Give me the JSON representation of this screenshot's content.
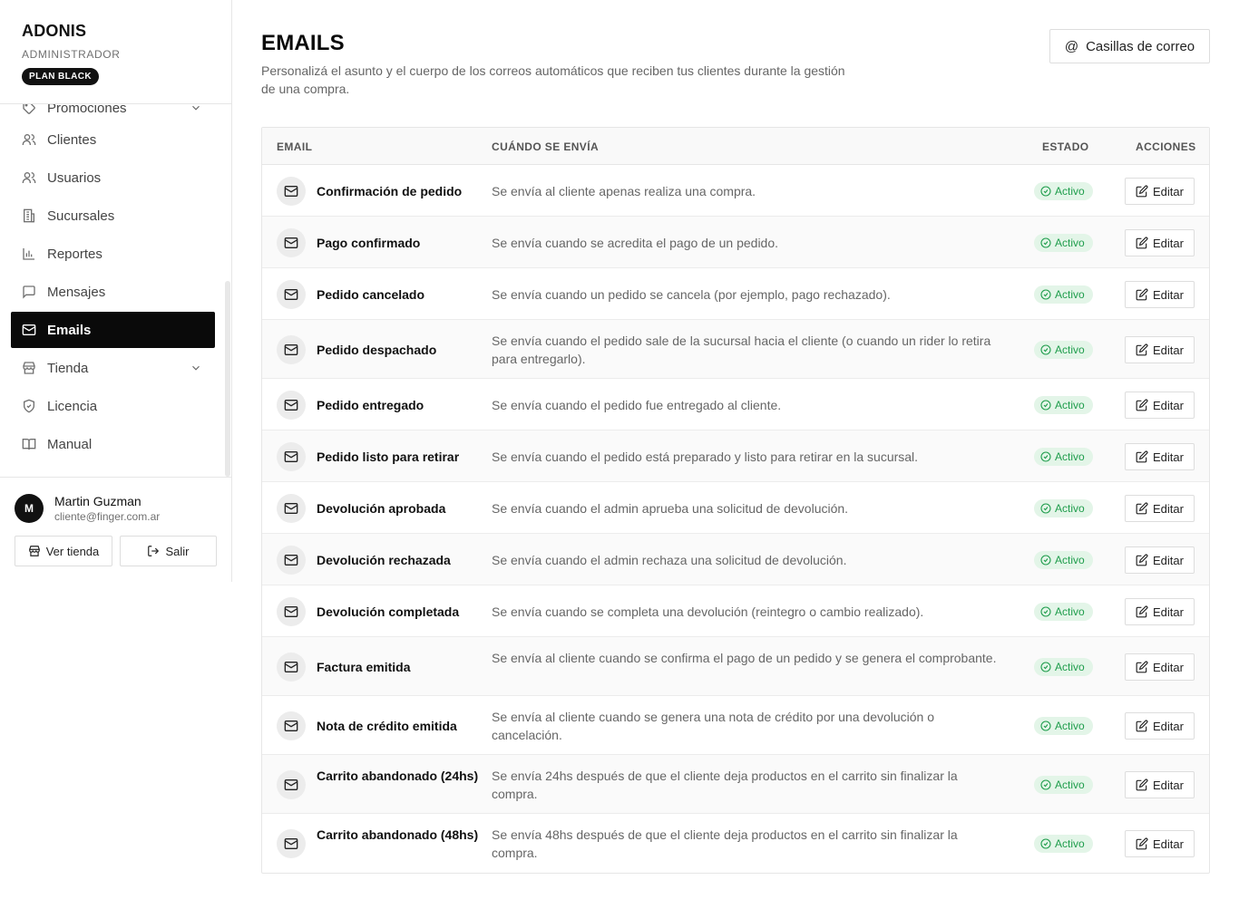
{
  "brand": {
    "name": "ADONIS",
    "role": "ADMINISTRADOR",
    "plan": "PLAN BLACK"
  },
  "sidebar": {
    "items": [
      {
        "label": "Promociones",
        "icon": "tag-icon"
      },
      {
        "label": "Clientes",
        "icon": "users-icon"
      },
      {
        "label": "Usuarios",
        "icon": "users-icon"
      },
      {
        "label": "Sucursales",
        "icon": "building-icon"
      },
      {
        "label": "Reportes",
        "icon": "bar-chart-icon"
      },
      {
        "label": "Mensajes",
        "icon": "message-icon"
      },
      {
        "label": "Emails",
        "icon": "mail-icon",
        "active": true
      },
      {
        "label": "Tienda",
        "icon": "store-icon",
        "expandable": true
      },
      {
        "label": "Licencia",
        "icon": "shield-check-icon"
      },
      {
        "label": "Manual",
        "icon": "book-icon"
      }
    ]
  },
  "user": {
    "initial": "M",
    "name": "Martin Guzman",
    "email": "cliente@finger.com.ar",
    "view_store_label": "Ver tienda",
    "logout_label": "Salir"
  },
  "page": {
    "title": "EMAILS",
    "description": "Personalizá el asunto y el cuerpo de los correos automáticos que reciben tus clientes durante la gestión de una compra.",
    "mailbox_button": "Casillas de correo"
  },
  "table": {
    "headers": {
      "email": "EMAIL",
      "when": "CUÁNDO SE ENVÍA",
      "status": "ESTADO",
      "actions": "ACCIONES"
    },
    "rows": [
      {
        "name": "Confirmación de pedido",
        "when": "Se envía al cliente apenas realiza una compra.",
        "status": "Activo",
        "action": "Editar"
      },
      {
        "name": "Pago confirmado",
        "when": "Se envía cuando se acredita el pago de un pedido.",
        "status": "Activo",
        "action": "Editar"
      },
      {
        "name": "Pedido cancelado",
        "when": "Se envía cuando un pedido se cancela (por ejemplo, pago rechazado).",
        "status": "Activo",
        "action": "Editar"
      },
      {
        "name": "Pedido despachado",
        "when": "Se envía cuando el pedido sale de la sucursal hacia el cliente (o cuando un rider lo retira para entregarlo).",
        "status": "Activo",
        "action": "Editar"
      },
      {
        "name": "Pedido entregado",
        "when": "Se envía cuando el pedido fue entregado al cliente.",
        "status": "Activo",
        "action": "Editar"
      },
      {
        "name": "Pedido listo para retirar",
        "when": "Se envía cuando el pedido está preparado y listo para retirar en la sucursal.",
        "status": "Activo",
        "action": "Editar"
      },
      {
        "name": "Devolución aprobada",
        "when": "Se envía cuando el admin aprueba una solicitud de devolución.",
        "status": "Activo",
        "action": "Editar"
      },
      {
        "name": "Devolución rechazada",
        "when": "Se envía cuando el admin rechaza una solicitud de devolución.",
        "status": "Activo",
        "action": "Editar"
      },
      {
        "name": "Devolución completada",
        "when": "Se envía cuando se completa una devolución (reintegro o cambio realizado).",
        "status": "Activo",
        "action": "Editar"
      },
      {
        "name": "Factura emitida",
        "when": "Se envía al cliente cuando se confirma el pago de un pedido y se genera el comprobante.",
        "status": "Activo",
        "action": "Editar"
      },
      {
        "name": "Nota de crédito emitida",
        "when": "Se envía al cliente cuando se genera una nota de crédito por una devolución o cancelación.",
        "status": "Activo",
        "action": "Editar"
      },
      {
        "name": "Carrito abandonado (24hs)",
        "when": "Se envía 24hs después de que el cliente deja productos en el carrito sin finalizar la compra.",
        "status": "Activo",
        "action": "Editar"
      },
      {
        "name": "Carrito abandonado (48hs)",
        "when": "Se envía 48hs después de que el cliente deja productos en el carrito sin finalizar la compra.",
        "status": "Activo",
        "action": "Editar"
      }
    ]
  },
  "colors": {
    "active_nav_bg": "#0a0a0a",
    "status_bg": "#e3f5e8",
    "status_text": "#1f9d4c"
  }
}
